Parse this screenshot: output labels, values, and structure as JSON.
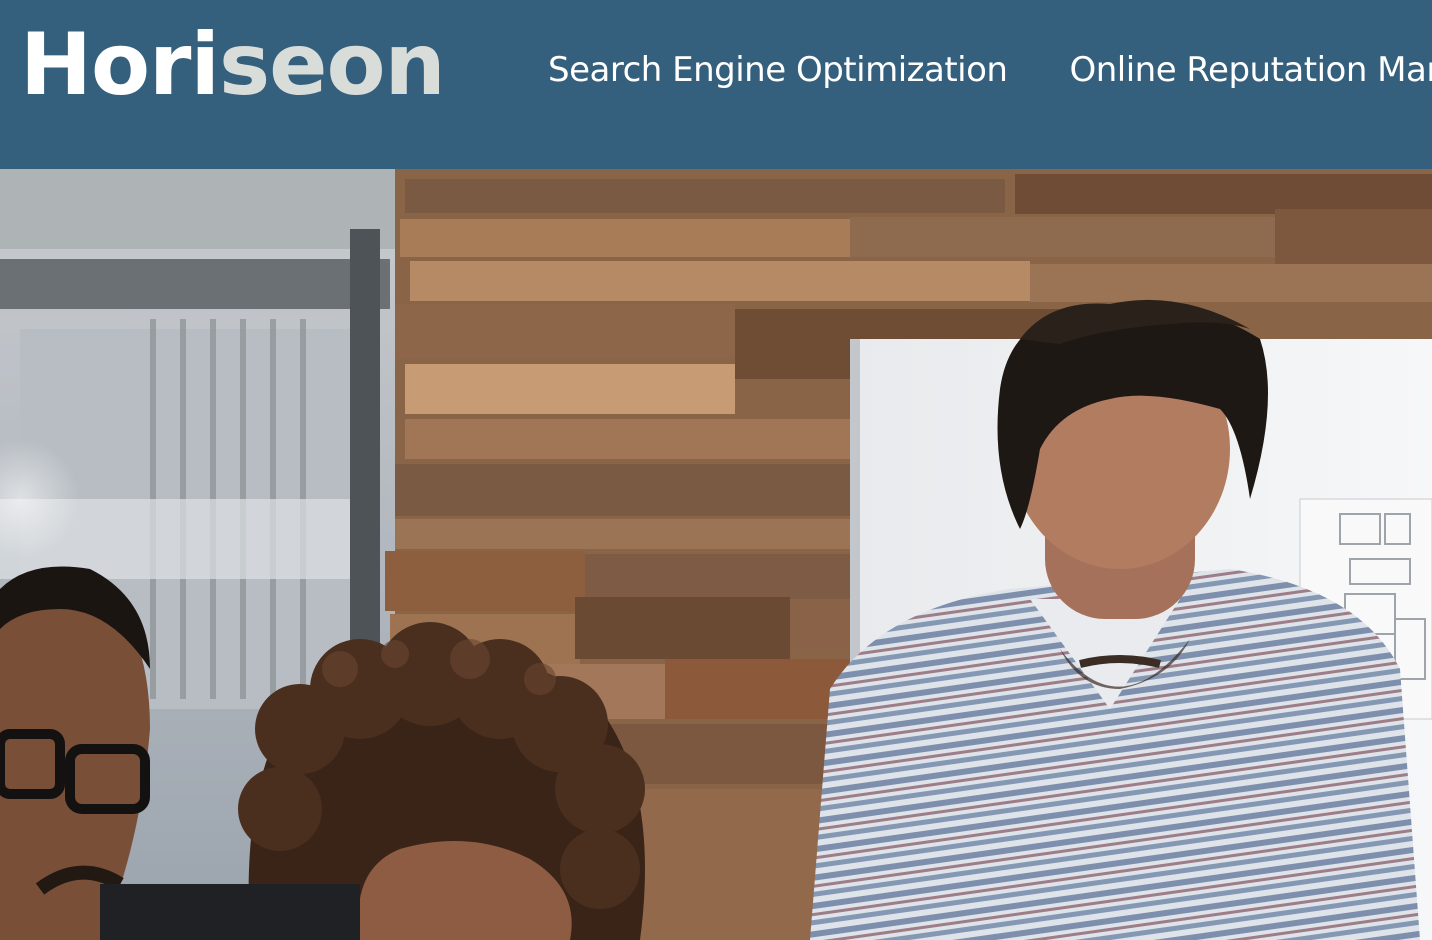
{
  "header": {
    "logo": {
      "part1": "Hori",
      "part2": "seon",
      "color_primary": "#ffffff",
      "color_secondary": "#d9ddd9"
    },
    "nav": [
      {
        "label": "Search Engine Optimization"
      },
      {
        "label": "Online Reputation Man"
      }
    ],
    "background": "#35607d"
  },
  "hero": {
    "image_subject": "team-meeting-photo"
  }
}
